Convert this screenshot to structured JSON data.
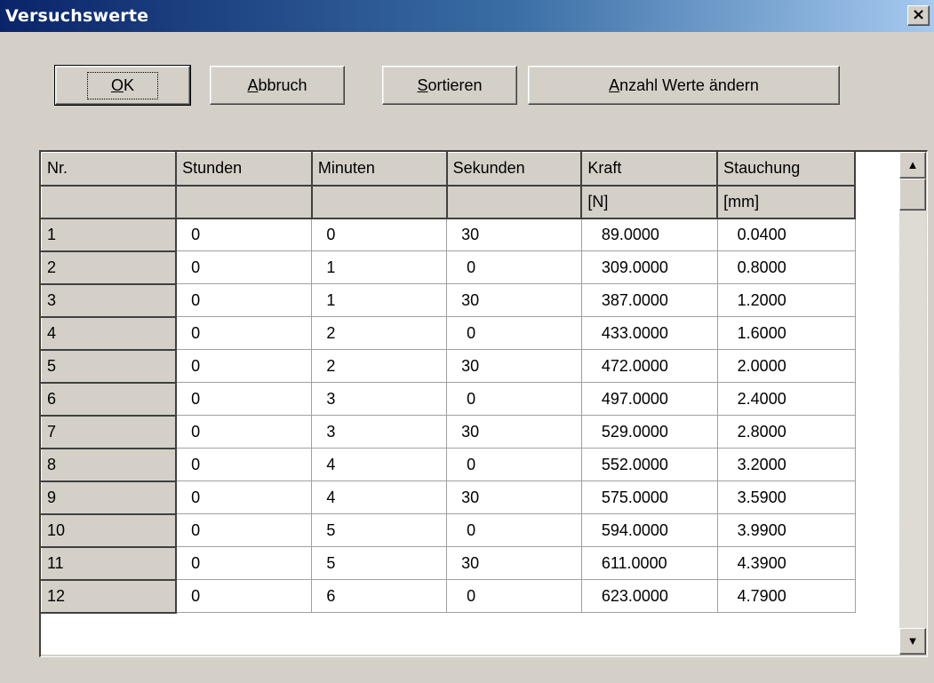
{
  "window": {
    "title": "Versuchswerte",
    "close_label": "×"
  },
  "buttons": {
    "ok": {
      "pre": "",
      "u": "O",
      "post": "K"
    },
    "abbruch": {
      "pre": "",
      "u": "A",
      "post": "bbruch"
    },
    "sortieren": {
      "pre": "",
      "u": "S",
      "post": "ortieren"
    },
    "anzahl": {
      "pre": "",
      "u": "A",
      "post": "nzahl Werte ändern"
    }
  },
  "table": {
    "headers": [
      "Nr.",
      "Stunden",
      "Minuten",
      "Sekunden",
      "Kraft",
      "Stauchung"
    ],
    "units": [
      "",
      "",
      "",
      "",
      "[N]",
      "[mm]"
    ],
    "rows": [
      [
        "1",
        "0",
        "0",
        "30",
        "89.0000",
        "0.0400"
      ],
      [
        "2",
        "0",
        "1",
        "0",
        "309.0000",
        "0.8000"
      ],
      [
        "3",
        "0",
        "1",
        "30",
        "387.0000",
        "1.2000"
      ],
      [
        "4",
        "0",
        "2",
        "0",
        "433.0000",
        "1.6000"
      ],
      [
        "5",
        "0",
        "2",
        "30",
        "472.0000",
        "2.0000"
      ],
      [
        "6",
        "0",
        "3",
        "0",
        "497.0000",
        "2.4000"
      ],
      [
        "7",
        "0",
        "3",
        "30",
        "529.0000",
        "2.8000"
      ],
      [
        "8",
        "0",
        "4",
        "0",
        "552.0000",
        "3.2000"
      ],
      [
        "9",
        "0",
        "4",
        "30",
        "575.0000",
        "3.5900"
      ],
      [
        "10",
        "0",
        "5",
        "0",
        "594.0000",
        "3.9900"
      ],
      [
        "11",
        "0",
        "5",
        "30",
        "611.0000",
        "4.3900"
      ],
      [
        "12",
        "0",
        "6",
        "0",
        "623.0000",
        "4.7900"
      ]
    ]
  },
  "scrollbar": {
    "up_icon": "arrow-up-icon",
    "down_icon": "arrow-down-icon",
    "up_glyph": "▲",
    "down_glyph": "▼"
  }
}
